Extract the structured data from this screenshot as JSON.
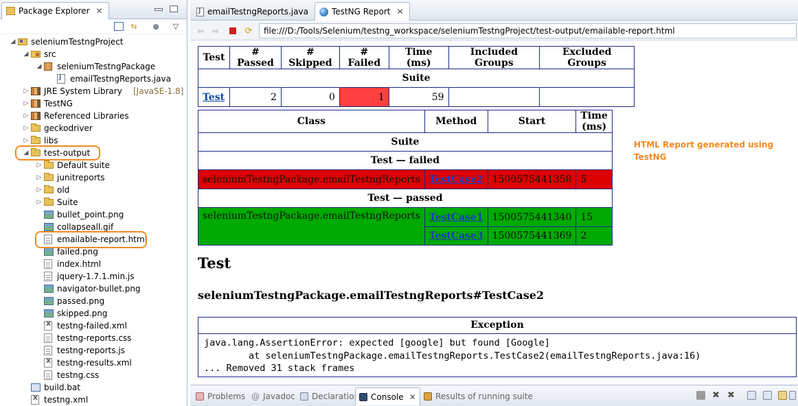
{
  "explorer": {
    "tab_label": "Package Explorer",
    "close_glyph": "✕",
    "tree": [
      {
        "label": "seleniumTestngProject",
        "icon": "project-icon",
        "expanded": true
      },
      {
        "label": "src",
        "icon": "source-folder-icon",
        "expanded": true
      },
      {
        "label": "seleniumTestngPackage",
        "icon": "package-icon",
        "expanded": true
      },
      {
        "label": "emailTestngReports.java",
        "icon": "java-file-icon",
        "expanded": false
      },
      {
        "label": "JRE System Library",
        "decoration": "[JavaSE-1.8]",
        "icon": "library-icon",
        "expanded": false
      },
      {
        "label": "TestNG",
        "icon": "library-icon",
        "expanded": false
      },
      {
        "label": "Referenced Libraries",
        "icon": "library-icon",
        "expanded": false
      },
      {
        "label": "geckodriver",
        "icon": "folder-icon",
        "expanded": false
      },
      {
        "label": "libs",
        "icon": "folder-icon",
        "expanded": false
      },
      {
        "label": "test-output",
        "icon": "folder-icon",
        "expanded": true
      },
      {
        "label": "Default suite",
        "icon": "folder-icon",
        "expanded": false
      },
      {
        "label": "junitreports",
        "icon": "folder-icon",
        "expanded": false
      },
      {
        "label": "old",
        "icon": "folder-icon",
        "expanded": false
      },
      {
        "label": "Suite",
        "icon": "folder-icon",
        "expanded": false
      },
      {
        "label": "bullet_point.png",
        "icon": "image-file-icon"
      },
      {
        "label": "collapseall.gif",
        "icon": "image-file-icon"
      },
      {
        "label": "emailable-report.html",
        "icon": "html-file-icon"
      },
      {
        "label": "failed.png",
        "icon": "image-file-icon"
      },
      {
        "label": "index.html",
        "icon": "html-file-icon"
      },
      {
        "label": "jquery-1.7.1.min.js",
        "icon": "js-file-icon"
      },
      {
        "label": "navigator-bullet.png",
        "icon": "image-file-icon"
      },
      {
        "label": "passed.png",
        "icon": "image-file-icon"
      },
      {
        "label": "skipped.png",
        "icon": "image-file-icon"
      },
      {
        "label": "testng-failed.xml",
        "icon": "xml-file-icon"
      },
      {
        "label": "testng-reports.css",
        "icon": "css-file-icon"
      },
      {
        "label": "testng-reports.js",
        "icon": "js-file-icon"
      },
      {
        "label": "testng-results.xml",
        "icon": "xml-file-icon"
      },
      {
        "label": "testng.css",
        "icon": "css-file-icon"
      },
      {
        "label": "build.bat",
        "icon": "bat-file-icon"
      },
      {
        "label": "testng.xml",
        "icon": "xml-file-icon"
      }
    ]
  },
  "editor": {
    "tabs": [
      {
        "label": "emailTestngReports.java",
        "active": false
      },
      {
        "label": "TestNG Report",
        "active": true
      }
    ],
    "close_glyph": "✕",
    "url": "file:///D:/Tools/Selenium/testng_workspace/seleniumTestngProject/test-output/emailable-report.html"
  },
  "report": {
    "summary": {
      "headers": [
        "Test",
        "# Passed",
        "# Skipped",
        "# Failed",
        "Time (ms)",
        "Included Groups",
        "Excluded Groups"
      ],
      "suite_label": "Suite",
      "row": {
        "test": "Test",
        "passed": "2",
        "skipped": "0",
        "failed": "1",
        "time": "59",
        "included": "",
        "excluded": ""
      }
    },
    "details": {
      "headers": [
        "Class",
        "Method",
        "Start",
        "Time (ms)"
      ],
      "suite_label": "Suite",
      "failed_label": "Test — failed",
      "passed_label": "Test — passed",
      "failed_rows": [
        {
          "class": "seleniumTestngPackage.emailTestngReports",
          "method": "TestCase2",
          "start": "1500575441358",
          "time": "5"
        }
      ],
      "passed_class": "seleniumTestngPackage.emailTestngReports",
      "passed_rows": [
        {
          "method": "TestCase1",
          "start": "1500575441340",
          "time": "15"
        },
        {
          "method": "TestCase3",
          "start": "1500575441369",
          "time": "2"
        }
      ]
    },
    "test_heading": "Test",
    "method_heading": "seleniumTestngPackage.emailTestngReports#TestCase2",
    "exception": {
      "header": "Exception",
      "lines": [
        "java.lang.AssertionError: expected [google] but found [Google]",
        "\tat seleniumTestngPackage.emailTestngReports.TestCase2(emailTestngReports.java:16)",
        "... Removed 31 stack frames"
      ]
    }
  },
  "annotation": {
    "text": "HTML Report generated using TestNG"
  },
  "bottom_tabs": [
    {
      "label": "Problems",
      "icon": "problems-icon",
      "active": false
    },
    {
      "label": "Javadoc",
      "icon": "javadoc-icon",
      "active": false
    },
    {
      "label": "Declaration",
      "icon": "declaration-icon",
      "active": false
    },
    {
      "label": "Console",
      "icon": "console-icon",
      "active": true
    },
    {
      "label": "Results of running suite",
      "icon": "testng-results-icon",
      "active": false
    }
  ],
  "colors": {
    "highlight": "#f08a24",
    "failed_row": "#dd0000",
    "passed_row": "#00aa00",
    "failed_count_cell": "#ff4040",
    "table_border": "#1f2a88"
  }
}
